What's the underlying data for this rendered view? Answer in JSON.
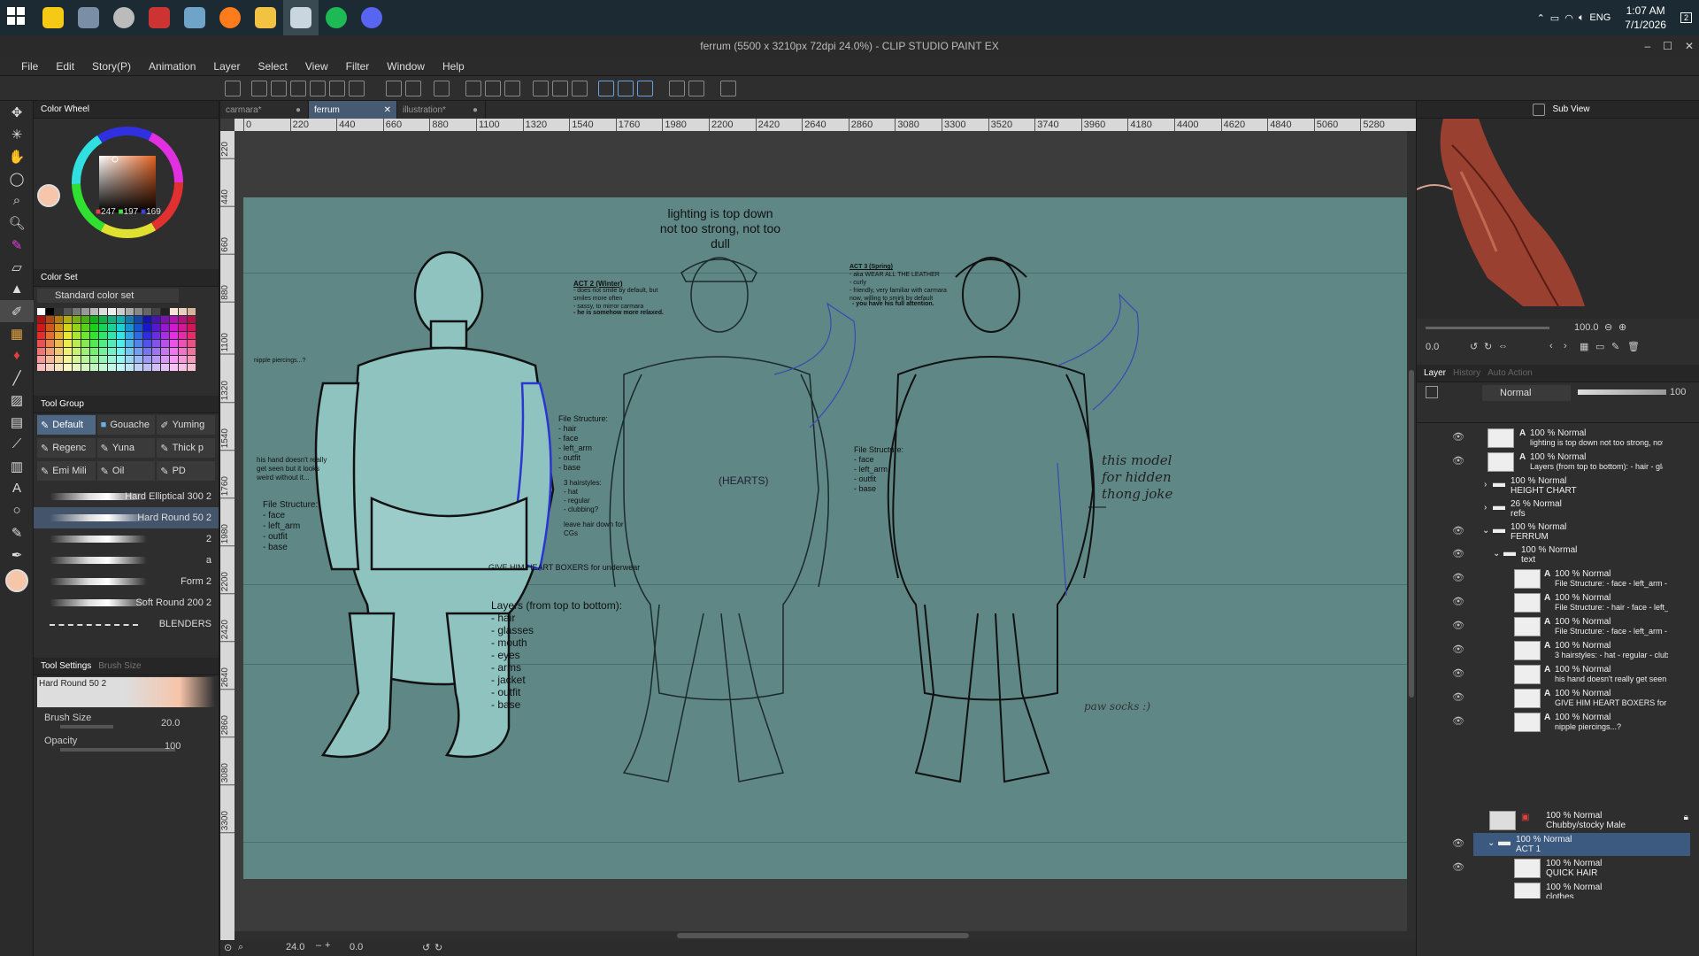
{
  "taskbar": {
    "apps": [
      {
        "name": "windows-start-icon",
        "color": "#ffffff"
      },
      {
        "name": "sticky-notes-icon",
        "color": "#f6c915"
      },
      {
        "name": "calculator-icon",
        "color": "#7a8ea6"
      },
      {
        "name": "shield-app-icon",
        "color": "#bbbbbb"
      },
      {
        "name": "ink-app-icon",
        "color": "#cc3333"
      },
      {
        "name": "paint-app-icon",
        "color": "#6fa3c8"
      },
      {
        "name": "firefox-icon",
        "color": "#ff7b1c"
      },
      {
        "name": "file-explorer-icon",
        "color": "#f2c243"
      },
      {
        "name": "clip-studio-icon",
        "color": "#c9d6e0"
      },
      {
        "name": "spotify-icon",
        "color": "#1db954"
      },
      {
        "name": "discord-icon",
        "color": "#5865f2"
      }
    ],
    "language": "ENG",
    "time": "1:07 AM",
    "date": "7/1/2026",
    "notification_count": "2"
  },
  "window": {
    "title": "ferrum (5500 x 3210px 72dpi 24.0%) - CLIP STUDIO PAINT EX"
  },
  "menu": [
    "File",
    "Edit",
    "Story(P)",
    "Animation",
    "Layer",
    "Select",
    "View",
    "Filter",
    "Window",
    "Help"
  ],
  "color_panel": {
    "tab_label": "Color Wheel",
    "r": "247",
    "g": "197",
    "b": "169",
    "current_color": "#f7c5a9"
  },
  "color_set": {
    "tab_label": "Color Set",
    "set_name": "Standard color set"
  },
  "tool_group": {
    "tab_label": "Tool Group",
    "items": [
      "Default",
      "Gouache",
      "Yuming",
      "Regenc",
      "Yuna",
      "Thick p",
      "Emi Mili",
      "Oil",
      "PD"
    ]
  },
  "brushes": [
    "Hard Elliptical 300 2",
    "Hard Round 50 2",
    "2",
    "a",
    "Form 2",
    "Soft Round 200 2",
    "BLENDERS"
  ],
  "tool_settings": {
    "tab_label": "Tool Settings",
    "tab2_label": "Brush Size",
    "brush_name": "Hard Round 50 2",
    "brush_size_label": "Brush Size",
    "brush_size_value": "20.0",
    "opacity_label": "Opacity",
    "opacity_value": "100"
  },
  "doc_tabs": [
    "carmara*",
    "ferrum",
    "illustration*"
  ],
  "ruler_h": [
    "0",
    "220",
    "440",
    "660",
    "880",
    "1100",
    "1320",
    "1540",
    "1760",
    "1980",
    "2200",
    "2420",
    "2640",
    "2860",
    "3080",
    "3300",
    "3520",
    "3740",
    "3960",
    "4180",
    "4400",
    "4620",
    "4840",
    "5060",
    "5280"
  ],
  "ruler_v": [
    "220",
    "440",
    "660",
    "880",
    "1100",
    "1320",
    "1540",
    "1760",
    "1980",
    "2200",
    "2420",
    "2640",
    "2860",
    "3080",
    "3300"
  ],
  "canvas": {
    "lighting_title": "lighting is top down\nnot too strong, not too dull",
    "nipple_note": "nipple piercings...?",
    "hand_note": "his hand doesn't really\nget seen but it looks\nweird without it...",
    "fs_act1": "File Structure:\n- face\n- left_arm\n- outfit\n- base",
    "act2_title": "ACT 2 (Winter)",
    "act2_notes": "- does not smile by default, but\n  smiles more often\n- sassy, to mirror carmara",
    "act2_bold": "- he is somehow more relaxed.",
    "fs_act2": "File Structure:\n- hair\n- face\n- left_arm\n- outfit\n- base",
    "hairstyles": "3 hairstyles:\n- hat\n- regular\n- clubbing?",
    "hair_down": "leave hair down for\nCGs",
    "boxers": "GIVE HIM HEART BOXERS for underwear",
    "layers_note": "Layers (from top to bottom):\n- hair\n- glasses\n- mouth\n- eyes\n- arms\n- jacket\n- outfit\n- base",
    "hearts": "(HEARTS)",
    "act3_title": "ACT 3 (Spring)",
    "act3_notes": "- aka WEAR ALL THE LEATHER\n- curly\n- friendly, very familiar with carmara\n  now, willing to smirk by default",
    "act3_bold": "- you have his full attention.",
    "fs_act3": "File Structure:\n- face\n- left_arm\n- outfit\n- base",
    "handwritten": "this model\nfor hidden\nthong joke",
    "paw_socks": "paw socks :)"
  },
  "status": {
    "zoom": "24.0",
    "angle": "0.0"
  },
  "sub_view": {
    "tab_label": "Sub View",
    "zoom": "100.0",
    "angle": "0.0"
  },
  "layer_panel": {
    "tabs": [
      "Layer",
      "History",
      "Auto Action"
    ],
    "blend_mode": "Normal",
    "opacity": "100",
    "layers": [
      {
        "top": "100 % Normal",
        "name": "lighting is top down not too strong, not too d..."
      },
      {
        "top": "100 % Normal",
        "name": "Layers (from top to bottom): - hair - glasses -..."
      },
      {
        "top": "100 % Normal",
        "name": "HEIGHT CHART"
      },
      {
        "top": "26 % Normal",
        "name": "refs"
      },
      {
        "top": "100 % Normal",
        "name": "FERRUM"
      },
      {
        "top": "100 % Normal",
        "name": "text"
      },
      {
        "top": "100 % Normal",
        "name": "File Structure: - face - left_arm - outfi"
      },
      {
        "top": "100 % Normal",
        "name": "File Structure: - hair - face - left_arm"
      },
      {
        "top": "100 % Normal",
        "name": "File Structure: - face - left_arm - outfi"
      },
      {
        "top": "100 % Normal",
        "name": "3 hairstyles: - hat - regular - clubbing"
      },
      {
        "top": "100 % Normal",
        "name": "his hand doesn't really get seen but"
      },
      {
        "top": "100 % Normal",
        "name": "GIVE HIM HEART BOXERS for und"
      },
      {
        "top": "100 % Normal",
        "name": "nipple piercings...?"
      },
      {
        "top": "100 % Normal",
        "name": "Chubby/stocky  Male"
      },
      {
        "top": "100 % Normal",
        "name": "ACT 1"
      },
      {
        "top": "100 % Normal",
        "name": "QUICK HAIR"
      },
      {
        "top": "100 % Normal",
        "name": "clothes"
      }
    ]
  }
}
